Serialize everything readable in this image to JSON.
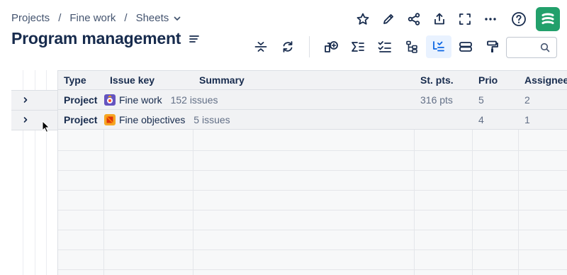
{
  "breadcrumb": {
    "items": [
      "Projects",
      "Fine work",
      "Sheets"
    ],
    "separator": "/"
  },
  "page": {
    "title": "Program management"
  },
  "top_actions": {
    "icons": [
      "star-icon",
      "pencil-icon",
      "share-icon",
      "export-icon",
      "fullscreen-icon",
      "more-icon",
      "help-icon",
      "app-logo"
    ]
  },
  "toolbar": {
    "icons": [
      "collapse-rows-icon",
      "refresh-icon",
      "add-structure-icon",
      "sum-icon",
      "checklist-icon",
      "hierarchy-icon",
      "filter-hierarchy-icon",
      "row-height-icon",
      "format-painter-icon"
    ],
    "active": "filter-hierarchy-icon",
    "search_placeholder": ""
  },
  "table": {
    "columns": [
      "Type",
      "Issue key",
      "Summary",
      "St. pts.",
      "Prio",
      "Assignee"
    ],
    "rows": [
      {
        "type": "Project",
        "issue_key": "Fine work",
        "issue_count": "152 issues",
        "story_points": "316 pts",
        "prio": "5",
        "assignee": "2",
        "icon": "project-avatar-icon"
      },
      {
        "type": "Project",
        "issue_key": "Fine objectives",
        "issue_count": "5 issues",
        "story_points": "",
        "prio": "4",
        "assignee": "1",
        "icon": "objectives-avatar-icon"
      }
    ]
  },
  "colors": {
    "accent": "#0c66e4",
    "brand_logo": "#22a06b",
    "project_icon": "#6554c0",
    "objectives_icon": "#f5a623"
  }
}
